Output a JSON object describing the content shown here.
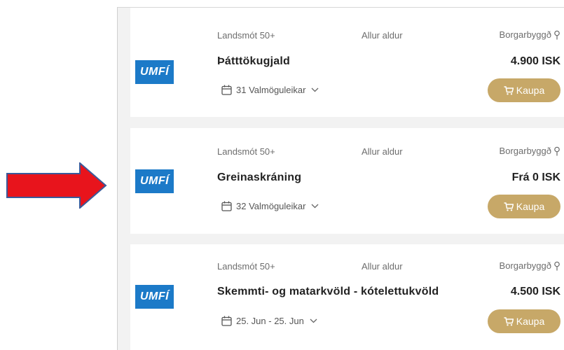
{
  "colors": {
    "accent": "#c7a868",
    "logo": "#1c7ac8",
    "arrow": "#e8141c"
  },
  "items": [
    {
      "logo_text": "UMFÍ",
      "category": "Landsmót 50+",
      "age": "Allur aldur",
      "location": "Borgarbyggð",
      "title": "Þátttökugjald",
      "price": "4.900 ISK",
      "options": "31 Valmöguleikar",
      "buy_label": "Kaupa"
    },
    {
      "logo_text": "UMFÍ",
      "category": "Landsmót 50+",
      "age": "Allur aldur",
      "location": "Borgarbyggð",
      "title": "Greinaskráning",
      "price": "Frá 0 ISK",
      "options": "32 Valmöguleikar",
      "buy_label": "Kaupa"
    },
    {
      "logo_text": "UMFÍ",
      "category": "Landsmót 50+",
      "age": "Allur aldur",
      "location": "Borgarbyggð",
      "title": "Skemmti- og matarkvöld - kótelettukvöld",
      "price": "4.500 ISK",
      "options": "25. Jun - 25. Jun",
      "buy_label": "Kaupa"
    }
  ]
}
